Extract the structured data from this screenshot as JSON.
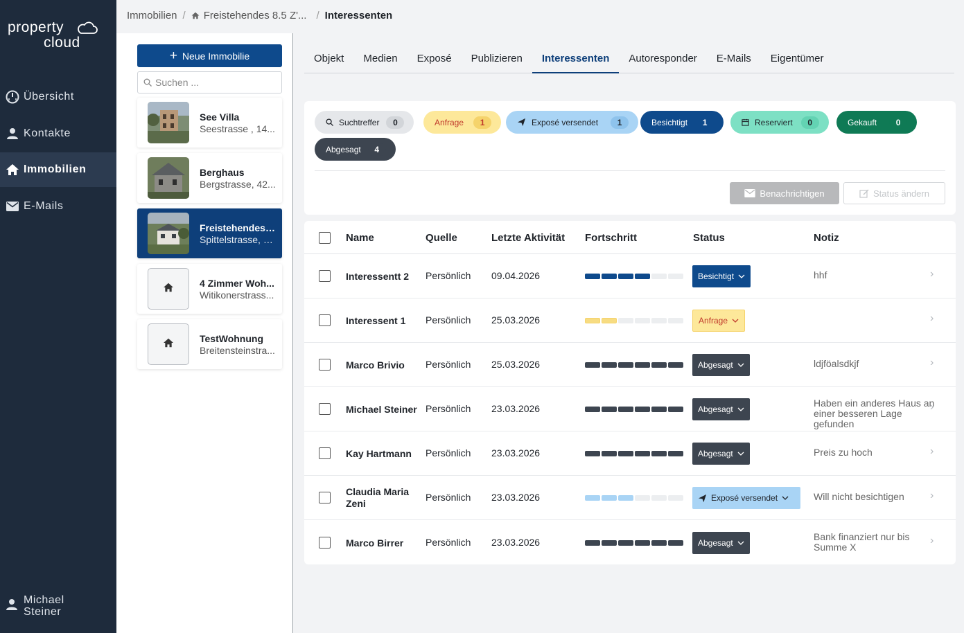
{
  "sidebar": {
    "logo_line1": "property",
    "logo_line2": "cloud",
    "nav": [
      {
        "label": "Übersicht",
        "icon": "dashboard-icon"
      },
      {
        "label": "Kontakte",
        "icon": "person-icon"
      },
      {
        "label": "Immobilien",
        "icon": "home-icon",
        "active": true
      },
      {
        "label": "E-Mails",
        "icon": "mail-icon"
      }
    ],
    "user_line1": "Michael",
    "user_line2": "Steiner"
  },
  "breadcrumb": {
    "root": "Immobilien",
    "property": "Freistehendes 8.5 Z'...",
    "current": "Interessenten"
  },
  "property_list": {
    "new_button": "Neue Immobilie",
    "search_placeholder": "Suchen ...",
    "items": [
      {
        "title": "See Villa",
        "subtitle": "Seestrasse , 14..."
      },
      {
        "title": "Berghaus",
        "subtitle": "Bergstrasse, 42..."
      },
      {
        "title": "Freistehendes ...",
        "subtitle": "Spittelstrasse, 1...",
        "active": true
      },
      {
        "title": "4 Zimmer Woh...",
        "subtitle": "Witikonerstrass..."
      },
      {
        "title": "TestWohnung",
        "subtitle": "Breitensteinstra..."
      }
    ]
  },
  "tabs": [
    "Objekt",
    "Medien",
    "Exposé",
    "Publizieren",
    "Interessenten",
    "Autoresponder",
    "E-Mails",
    "Eigentümer"
  ],
  "active_tab": "Interessenten",
  "filters": [
    {
      "label": "Suchtreffer",
      "count": "0"
    },
    {
      "label": "Anfrage",
      "count": "1"
    },
    {
      "label": "Exposé versendet",
      "count": "1"
    },
    {
      "label": "Besichtigt",
      "count": "1"
    },
    {
      "label": "Reserviert",
      "count": "0"
    },
    {
      "label": "Gekauft",
      "count": "0"
    },
    {
      "label": "Abgesagt",
      "count": "4"
    }
  ],
  "actions": {
    "notify": "Benachrichtigen",
    "change_status": "Status ändern"
  },
  "table": {
    "headers": [
      "Name",
      "Quelle",
      "Letzte Aktivität",
      "Fortschritt",
      "Status",
      "Notiz"
    ],
    "rows": [
      {
        "name": "Interessentt 2",
        "source": "Persönlich",
        "date": "09.04.2026",
        "progress": 0.67,
        "status": "Besichtigt",
        "note": "hhf"
      },
      {
        "name": "Interessent 1",
        "source": "Persönlich",
        "date": "25.03.2026",
        "progress": 0.33,
        "status": "Anfrage",
        "note": ""
      },
      {
        "name": "Marco Brivio",
        "source": "Persönlich",
        "date": "25.03.2026",
        "progress": 1.0,
        "status": "Abgesagt",
        "note": "ldjföalsdkjf"
      },
      {
        "name": "Michael Steiner",
        "source": "Persönlich",
        "date": "23.03.2026",
        "progress": 1.0,
        "status": "Abgesagt",
        "note": "Haben ein anderes Haus an einer besseren Lage gefunden"
      },
      {
        "name": "Kay Hartmann",
        "source": "Persönlich",
        "date": "23.03.2026",
        "progress": 1.0,
        "status": "Abgesagt",
        "note": "Preis zu hoch"
      },
      {
        "name": "Claudia Maria Zeni",
        "source": "Persönlich",
        "date": "23.03.2026",
        "progress": 0.5,
        "status": "Exposé versendet",
        "note": "Will nicht besichtigen"
      },
      {
        "name": "Marco Birrer",
        "source": "Persönlich",
        "date": "23.03.2026",
        "progress": 1.0,
        "status": "Abgesagt",
        "note": "Bank finanziert nur bis Summe X"
      }
    ]
  },
  "colors": {
    "sidebar_bg": "#1e2b3c",
    "primary": "#0e4a8c",
    "anfrage_bg": "#fde89a",
    "anfrage_text": "#c0392b",
    "expose_bg": "#a9d4f5",
    "besichtigt_bg": "#0e4a8c",
    "reserviert_bg": "#7de0c4",
    "gekauft_bg": "#0f7a55",
    "abgesagt_bg": "#3d4550"
  }
}
